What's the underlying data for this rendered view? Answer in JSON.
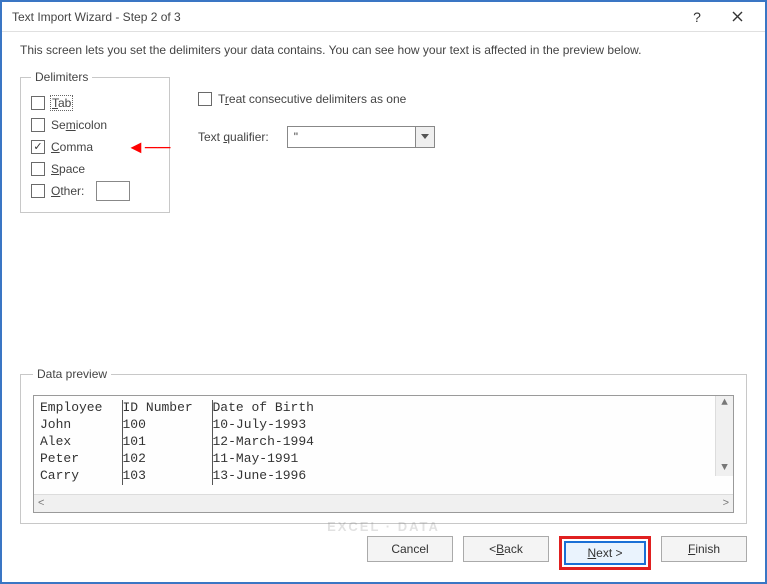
{
  "title": "Text Import Wizard - Step 2 of 3",
  "intro": "This screen lets you set the delimiters your data contains.  You can see how your text is affected in the preview below.",
  "delimiters": {
    "legend": "Delimiters",
    "tab": {
      "label": "Tab",
      "checked": false
    },
    "semicolon": {
      "label": "Semicolon",
      "checked": false
    },
    "comma": {
      "label": "Comma",
      "checked": true
    },
    "space": {
      "label": "Space",
      "checked": false
    },
    "other": {
      "label": "Other:",
      "checked": false,
      "value": ""
    }
  },
  "treat_consecutive": {
    "label": "Treat consecutive delimiters as one",
    "checked": false
  },
  "text_qualifier": {
    "label": "Text qualifier:",
    "value": "\""
  },
  "preview": {
    "legend": "Data preview",
    "headers": [
      "Employee",
      "ID Number",
      "Date of Birth"
    ],
    "rows": [
      [
        "John",
        "100",
        "10-July-1993"
      ],
      [
        "Alex",
        "101",
        "12-March-1994"
      ],
      [
        "Peter",
        "102",
        "11-May-1991"
      ],
      [
        "Carry",
        "103",
        "13-June-1996"
      ]
    ]
  },
  "buttons": {
    "cancel": "Cancel",
    "back": "< Back",
    "next": "Next >",
    "finish": "Finish"
  },
  "watermark": "EXCEL · DATA"
}
